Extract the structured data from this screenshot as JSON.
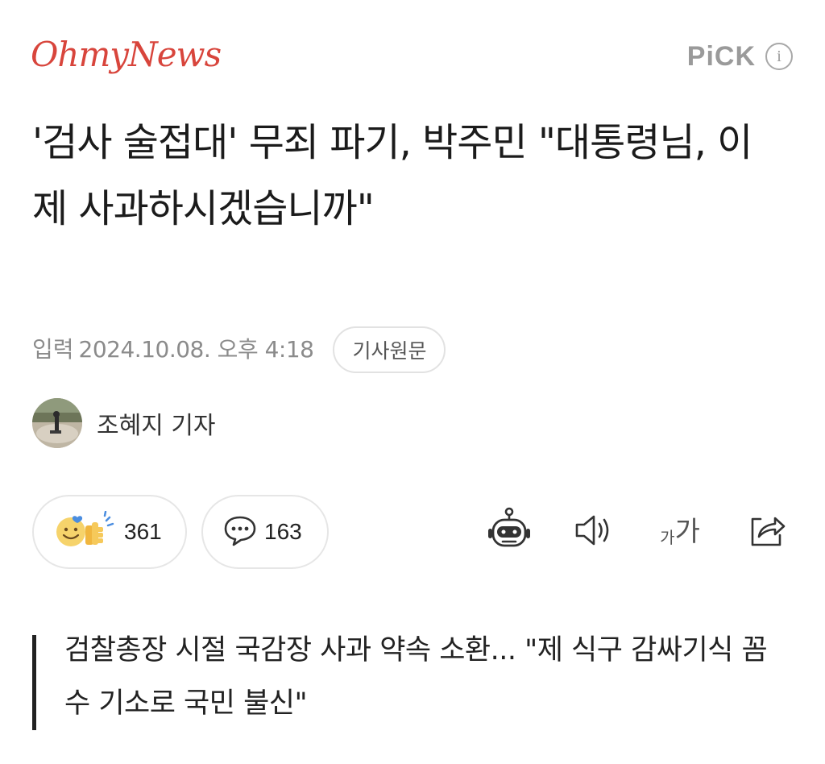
{
  "header": {
    "logo_text": "OhmyNews",
    "pick_label": "PiCK",
    "info_icon_glyph": "i",
    "logo_color": "#d8453c"
  },
  "article": {
    "headline": "'검사 술접대' 무죄 파기, 박주민 \"대통령님, 이제 사과하시겠습니까\"",
    "input_label": "입력",
    "input_datetime": "2024.10.08. 오후 4:18",
    "source_button_label": "기사원문",
    "reporter": "조혜지 기자"
  },
  "reactions": {
    "reaction_count": "361",
    "comment_count": "163",
    "font_size_small": "가",
    "font_size_large": "가"
  },
  "icons": {
    "reaction": "smiley-thumbs-up-icon",
    "comment": "speech-bubble-icon",
    "summary": "robot-icon",
    "audio": "speaker-icon",
    "font": "font-size-icon",
    "share": "share-icon"
  },
  "subheadline": "검찰총장 시절 국감장 사과 약속 소환... \"제 식구 감싸기식 꼼수 기소로 국민 불신\""
}
